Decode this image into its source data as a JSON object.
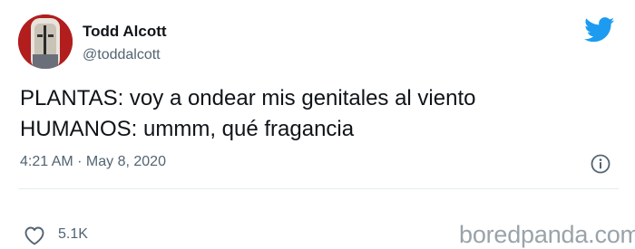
{
  "author": {
    "name": "Todd Alcott",
    "handle": "@toddalcott"
  },
  "tweet": {
    "lines": [
      "PLANTAS: voy a ondear mis genitales al viento",
      "HUMANOS: ummm, qué fragancia"
    ],
    "timestamp": "4:21 AM · May 8, 2020"
  },
  "actions": {
    "likes": "5.1K"
  },
  "watermark": "boredpanda.com",
  "colors": {
    "twitter_blue": "#1d9bf0",
    "secondary_text": "#536471",
    "avatar_bg": "#b21d1d"
  },
  "icons": [
    "twitter-bird-icon",
    "info-icon",
    "heart-icon"
  ]
}
